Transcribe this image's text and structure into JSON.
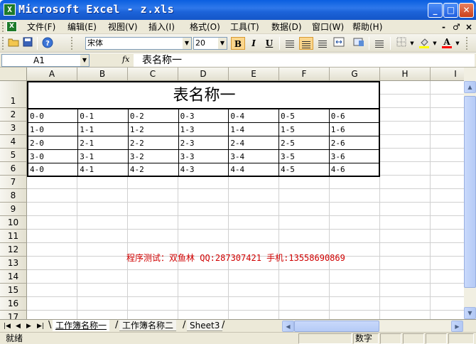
{
  "window": {
    "title": "Microsoft Excel - z.xls",
    "app_icon_glyph": "X",
    "buttons": [
      "_",
      "□",
      "✕"
    ]
  },
  "menu": {
    "items": [
      "文件(F)",
      "编辑(E)",
      "视图(V)",
      "插入(I)",
      "格式(O)",
      "工具(T)",
      "数据(D)",
      "窗口(W)",
      "帮助(H)"
    ],
    "doc_controls": [
      "-",
      "♂",
      "×"
    ]
  },
  "toolbar": {
    "font_name": "宋体",
    "font_size": "20",
    "bold_label": "B",
    "italic_label": "I",
    "underline_label": "U",
    "active_align": "center"
  },
  "formula_bar": {
    "name_box": "A1",
    "fx_label": "fx",
    "content": "表名称一"
  },
  "grid": {
    "columns": [
      "A",
      "B",
      "C",
      "D",
      "E",
      "F",
      "G",
      "H",
      "I"
    ],
    "rows": [
      "1",
      "2",
      "3",
      "4",
      "5",
      "6",
      "7",
      "8",
      "9",
      "10",
      "11",
      "12",
      "13",
      "14",
      "15",
      "16",
      "17"
    ],
    "table_title": "表名称一",
    "table_rows": [
      [
        "0-0",
        "0-1",
        "0-2",
        "0-3",
        "0-4",
        "0-5",
        "0-6"
      ],
      [
        "1-0",
        "1-1",
        "1-2",
        "1-3",
        "1-4",
        "1-5",
        "1-6"
      ],
      [
        "2-0",
        "2-1",
        "2-2",
        "2-3",
        "2-4",
        "2-5",
        "2-6"
      ],
      [
        "3-0",
        "3-1",
        "3-2",
        "3-3",
        "3-4",
        "3-5",
        "3-6"
      ],
      [
        "4-0",
        "4-1",
        "4-2",
        "4-3",
        "4-4",
        "4-5",
        "4-6"
      ]
    ],
    "annotation": "程序测试：双鱼林 QQ:287307421 手机:13558690869",
    "annotation_color": "#d00000"
  },
  "sheets": {
    "tabs": [
      "工作簿名称一",
      "工作簿名称二",
      "Sheet3"
    ],
    "active": 0,
    "nav": [
      "|◀",
      "◀",
      "▶",
      "▶|"
    ]
  },
  "status": {
    "ready": "就绪",
    "num_indicator": "数字"
  },
  "colors": {
    "titlebar": "#1c63d9",
    "chrome": "#ece9d8",
    "accent_active": "#fbd68c"
  }
}
